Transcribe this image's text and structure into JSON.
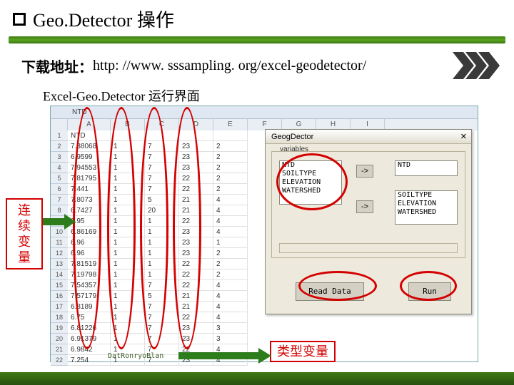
{
  "slide": {
    "title": "Geo.Detector 操作",
    "url_label": "下载地址：",
    "url": "http: //www. sssampling. org/excel-geodetector/",
    "screenshot_caption": "Excel-Geo.Detector 运行界面"
  },
  "spreadsheet": {
    "formula_bar": "NTD",
    "col_letters": [
      "A",
      "B",
      "C",
      "D",
      "E",
      "F",
      "G",
      "H",
      "I"
    ],
    "header_row": [
      "NTD",
      "SOILTYPE",
      "ELEVATION",
      "WATERSHED"
    ],
    "rows": [
      {
        "n": "1",
        "a": "NTD",
        "b": "",
        "c": "",
        "d": "",
        "e": ""
      },
      {
        "n": "2",
        "a": "7.38068",
        "b": "1",
        "c": "7",
        "d": "23",
        "e": "2"
      },
      {
        "n": "3",
        "a": "6.9599",
        "b": "1",
        "c": "7",
        "d": "23",
        "e": "2"
      },
      {
        "n": "4",
        "a": "7.94553",
        "b": "1",
        "c": "7",
        "d": "23",
        "e": "2"
      },
      {
        "n": "5",
        "a": "7.81795",
        "b": "1",
        "c": "7",
        "d": "22",
        "e": "2"
      },
      {
        "n": "6",
        "a": "7.441",
        "b": "1",
        "c": "7",
        "d": "22",
        "e": "2"
      },
      {
        "n": "7",
        "a": "7.8073",
        "b": "1",
        "c": "5",
        "d": "21",
        "e": "4"
      },
      {
        "n": "8",
        "a": "6.7427",
        "b": "1",
        "c": "20",
        "d": "21",
        "e": "4"
      },
      {
        "n": "9",
        "a": "6.95",
        "b": "1",
        "c": "1",
        "d": "22",
        "e": "4"
      },
      {
        "n": "10",
        "a": "6.86169",
        "b": "1",
        "c": "1",
        "d": "23",
        "e": "4"
      },
      {
        "n": "11",
        "a": "6.96",
        "b": "1",
        "c": "1",
        "d": "23",
        "e": "1"
      },
      {
        "n": "12",
        "a": "6.96",
        "b": "1",
        "c": "1",
        "d": "23",
        "e": "2"
      },
      {
        "n": "13",
        "a": "7.81519",
        "b": "1",
        "c": "1",
        "d": "22",
        "e": "2"
      },
      {
        "n": "14",
        "a": "7.19798",
        "b": "1",
        "c": "1",
        "d": "22",
        "e": "2"
      },
      {
        "n": "15",
        "a": "7.54357",
        "b": "1",
        "c": "7",
        "d": "22",
        "e": "4"
      },
      {
        "n": "16",
        "a": "7.57179",
        "b": "1",
        "c": "5",
        "d": "21",
        "e": "4"
      },
      {
        "n": "17",
        "a": "6.8189",
        "b": "1",
        "c": "7",
        "d": "21",
        "e": "4"
      },
      {
        "n": "18",
        "a": "6.75",
        "b": "1",
        "c": "7",
        "d": "22",
        "e": "4"
      },
      {
        "n": "19",
        "a": "6.81226",
        "b": "1",
        "c": "7",
        "d": "23",
        "e": "3"
      },
      {
        "n": "20",
        "a": "6.91379",
        "b": "1",
        "c": "7",
        "d": "23",
        "e": "3"
      },
      {
        "n": "21",
        "a": "6.9842",
        "b": "1",
        "c": "7",
        "d": "22",
        "e": "4"
      },
      {
        "n": "22",
        "a": "7.254",
        "b": "1",
        "c": "7",
        "d": "23",
        "e": "4"
      }
    ],
    "footer_path": "DatRonryoBlan"
  },
  "dialog": {
    "title": "GeogDector",
    "variables_label": "variables",
    "left_list": [
      "NTD",
      "SOILTYPE",
      "ELEVATION",
      "WATERSHED"
    ],
    "right_top_list": [
      "NTD"
    ],
    "right_bottom_list": [
      "SOILTYPE",
      "ELEVATION",
      "WATERSHED"
    ],
    "arrow": "->",
    "read_button": "Read Data",
    "run_button": "Run",
    "close": "✕"
  },
  "labels": {
    "continuous_var": "连续\n变量",
    "categorical_var": "类型变量"
  }
}
